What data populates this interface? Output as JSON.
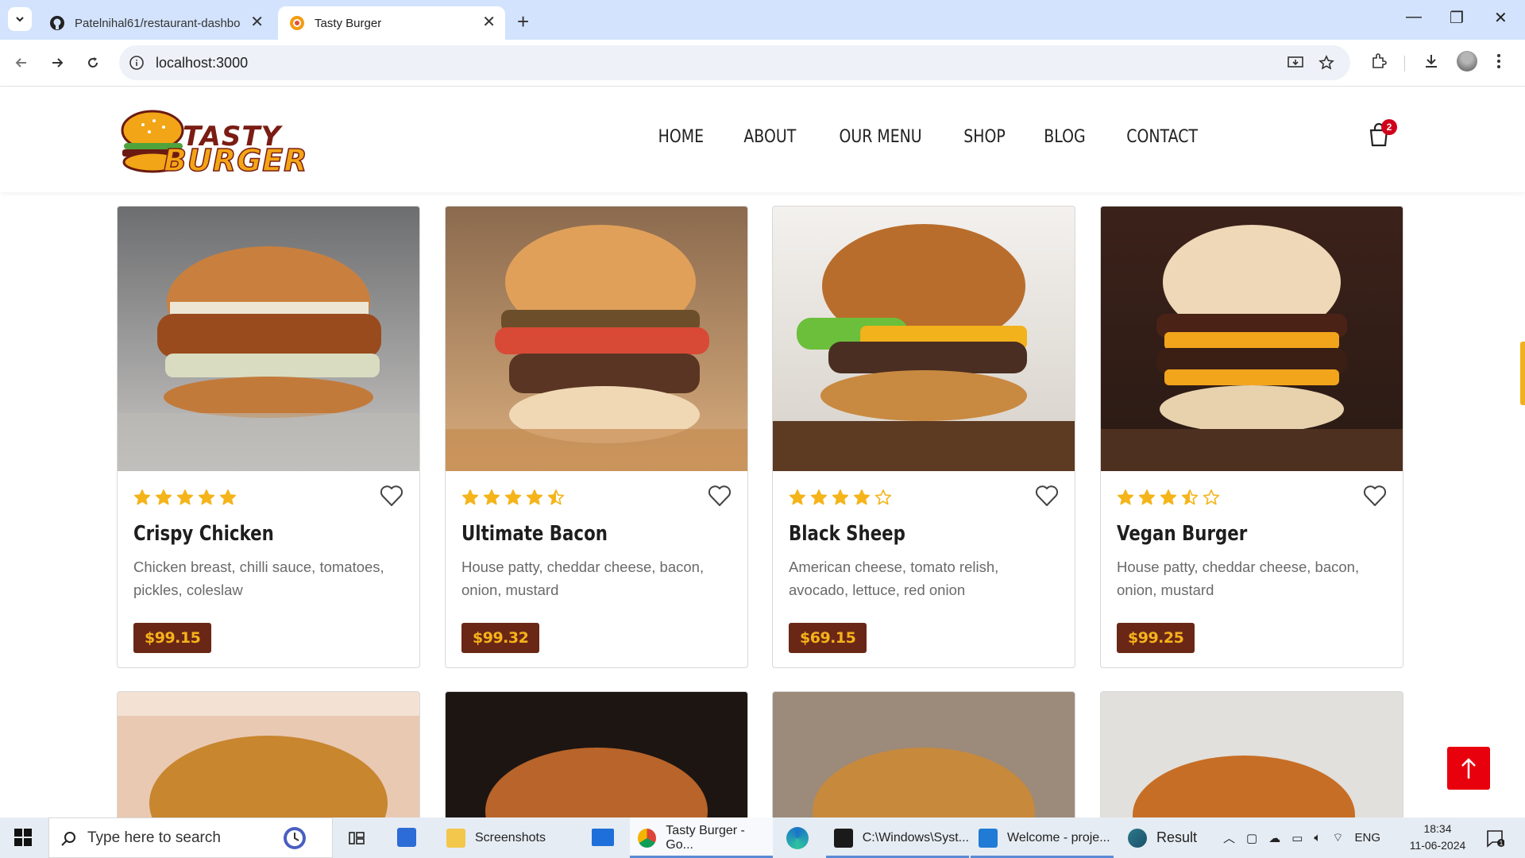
{
  "browser": {
    "tabs": [
      {
        "title": "Patelnihal61/restaurant-dashbo",
        "icon": "github-icon",
        "active": false
      },
      {
        "title": "Tasty Burger",
        "icon": "burger-favicon",
        "active": true
      }
    ],
    "url": "localhost:3000"
  },
  "site": {
    "logo": {
      "line1": "TASTY",
      "line2": "BURGER"
    },
    "nav": [
      "HOME",
      "ABOUT",
      "OUR MENU",
      "SHOP",
      "BLOG",
      "CONTACT"
    ],
    "cart_count": "2"
  },
  "products": [
    {
      "name": "Crispy Chicken",
      "description": "Chicken breast, chilli sauce, tomatoes, pickles, coleslaw",
      "price": "$99.15",
      "rating": 5
    },
    {
      "name": "Ultimate Bacon",
      "description": "House patty, cheddar cheese, bacon, onion, mustard",
      "price": "$99.32",
      "rating": 4.5
    },
    {
      "name": "Black Sheep",
      "description": "American cheese, tomato relish, avocado, lettuce, red onion",
      "price": "$69.15",
      "rating": 4
    },
    {
      "name": "Vegan Burger",
      "description": "House patty, cheddar cheese, bacon, onion, mustard",
      "price": "$99.25",
      "rating": 3.5
    }
  ],
  "taskbar": {
    "search_placeholder": "Type here to search",
    "apps": [
      "Screenshots",
      "Tasty Burger - Go...",
      "C:\\Windows\\Syst...",
      "Welcome - proje...",
      "Result"
    ],
    "language": "ENG",
    "time": "18:34",
    "date": "11-06-2024"
  },
  "colors": {
    "accent_red": "#e8000d",
    "price_bg": "#6a2716",
    "price_text": "#f6b21a",
    "star": "#f4b41a"
  }
}
